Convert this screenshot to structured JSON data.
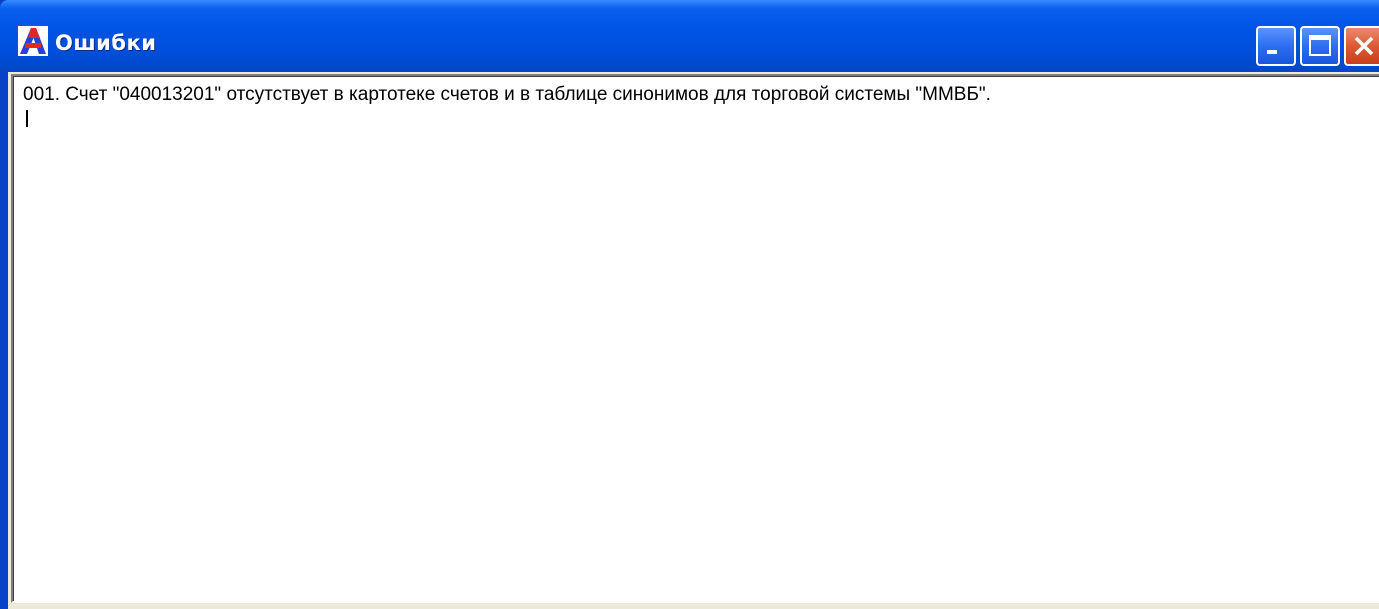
{
  "window": {
    "title": "Ошибки",
    "app_icon": "app-logo-icon",
    "buttons": {
      "minimize_icon": "minimize-icon",
      "maximize_icon": "maximize-icon",
      "close_icon": "close-icon"
    }
  },
  "memo": {
    "lines": [
      "001. Счет \"040013201\" отсутствует в картотеке счетов и в таблице синонимов для торговой системы \"ММВБ\"."
    ]
  },
  "colors": {
    "titlebar": "#0054e3",
    "close_button": "#db5a35",
    "memo_background": "#ffffff"
  }
}
